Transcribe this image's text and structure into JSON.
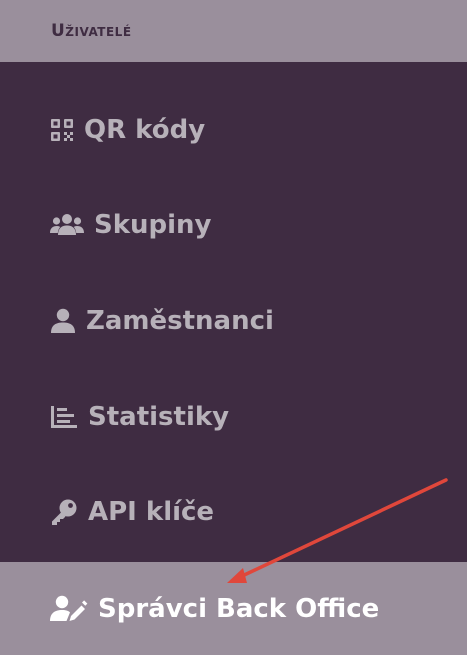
{
  "section": {
    "title": "Uživatelé"
  },
  "menu": {
    "items": [
      {
        "label": "QR kódy",
        "icon": "qr-code-icon"
      },
      {
        "label": "Skupiny",
        "icon": "users-group-icon"
      },
      {
        "label": "Zaměstnanci",
        "icon": "user-icon"
      },
      {
        "label": "Statistiky",
        "icon": "bar-list-icon"
      },
      {
        "label": "API klíče",
        "icon": "key-icon"
      }
    ],
    "active": {
      "label": "Správci Back Office",
      "icon": "user-edit-icon"
    }
  },
  "colors": {
    "sidebar_bg": "#3f2c42",
    "header_bg": "#9a8f9c",
    "item_text": "#b7b1b9",
    "active_text": "#ffffff",
    "arrow": "#e0473b"
  }
}
